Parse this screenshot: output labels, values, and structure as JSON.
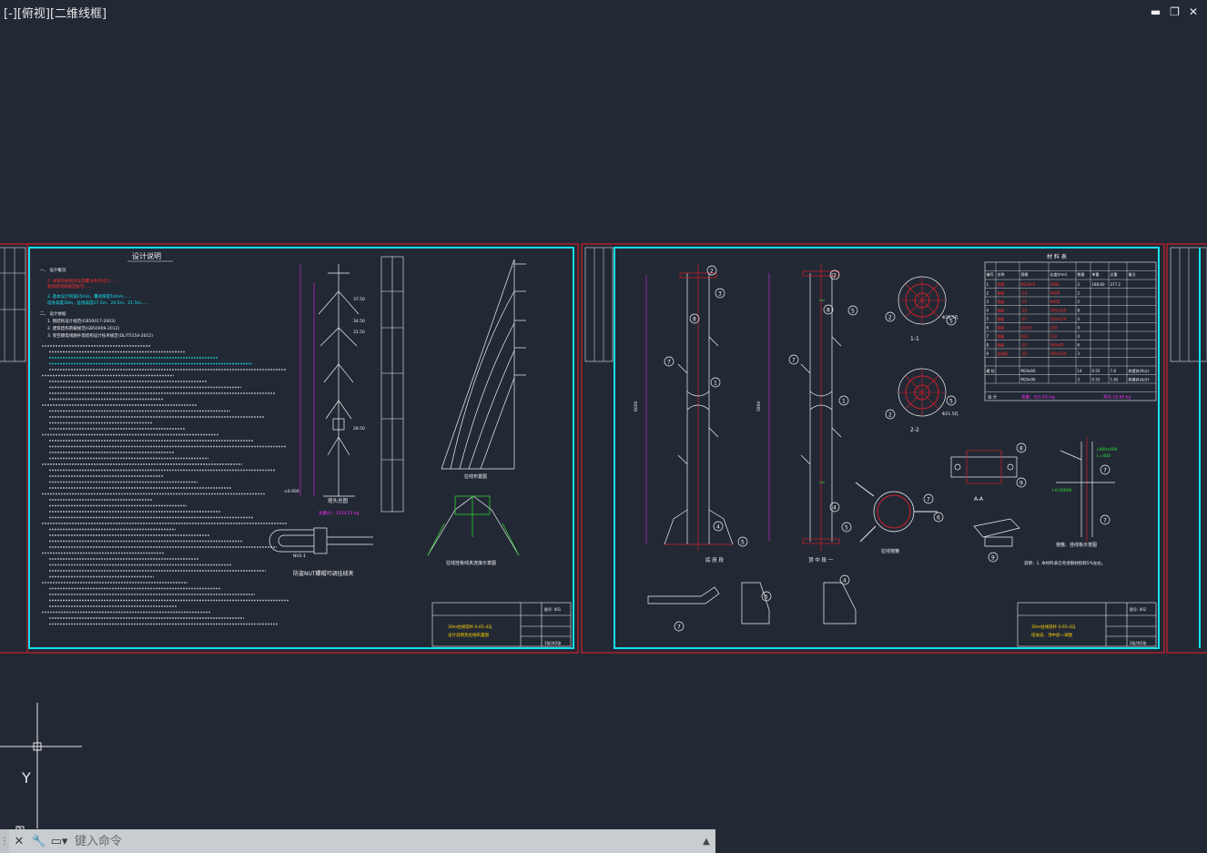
{
  "viewport": {
    "label": "[-][俯视][二维线框]"
  },
  "window_controls": {
    "minimize": "▬",
    "restore": "❐",
    "close": "✕"
  },
  "sheet1": {
    "title": "设计说明",
    "notes_red": [
      "1. 本铁塔按照风压及覆冰条件设计……",
      "   铁塔接地按规范执行……"
    ],
    "notes_cyan": [
      "2. 基本设计风速25m/s，覆冰厚度10mm……",
      "   塔身高度30m，挂线高度27.5m、24.5m、21.5m……"
    ],
    "ref_items": [
      "1. 钢结构设计规范(GB50017-2003)",
      "2. 建筑结构荷载规范(GB50009-2012)",
      "3. 架空输电线路杆塔结构设计技术规定(DL/T5154-2012)"
    ],
    "tower_caption": "塔头总图",
    "tower_weight": "总重(t)：1534.23 kg",
    "nut_caption": "防盗NUT螺帽可调挂线夹",
    "nu_label": "NU1-1",
    "diagram_caption": "拉线布置图",
    "detail_caption": "拉线挂板线夹连接示意图",
    "elevations": [
      "37.50",
      "34.50",
      "31.50",
      "28.50",
      "25.50",
      "±0.000"
    ],
    "title_block": {
      "project": "30m拉线塔杆-0.65-42J",
      "sub": "设计说明及拉线布置图",
      "drawing_no": "图号- 001",
      "scale": "比例",
      "sheet": "1张/共2张"
    }
  },
  "sheet2": {
    "table_title": "材 料 表",
    "table_headers": [
      "编号",
      "名称",
      "规格",
      "长度(mm)",
      "数量",
      "单重",
      "总重",
      "备注"
    ],
    "table_rows": [
      [
        "1",
        "钢管",
        "Φ219x6",
        "5984",
        "2",
        "188.60",
        "377.2",
        ""
      ],
      [
        "2",
        "钢板",
        "-14",
        "Φ500",
        "2",
        "",
        "",
        ""
      ],
      [
        "3",
        "钢板",
        "-16",
        "Φ400",
        "2",
        "",
        "",
        ""
      ],
      [
        "4",
        "钢板",
        "-10",
        "300x250",
        "8",
        "",
        "",
        ""
      ],
      [
        "5",
        "钢板",
        "-25",
        "250x150",
        "4",
        "",
        "",
        ""
      ],
      [
        "6",
        "钢板",
        "L63x5",
        "200",
        "4",
        "",
        "",
        ""
      ],
      [
        "7",
        "钢板",
        "Φ22",
        "150",
        "4",
        "",
        "",
        ""
      ],
      [
        "8",
        "钢板",
        "-10",
        "360x60",
        "6",
        "",
        "",
        ""
      ],
      [
        "9",
        "挂线板",
        "-10",
        "260x100",
        "3",
        "",
        "",
        ""
      ]
    ],
    "bolt_rows": [
      [
        "螺 栓",
        "M20x60",
        "14",
        "0.55",
        "7.8",
        "热镀锌(共计)"
      ],
      [
        "",
        "M20x90",
        "3",
        "0.55",
        "1.65",
        "热镀锌(共计)"
      ]
    ],
    "total_label": "合 计",
    "total_value": "总重：5(5.43) kg",
    "total_value2": "共计 10.65 kg",
    "section1": "1-1",
    "section2": "2-2",
    "section_aa": "A-A",
    "caption_base": "底 座 段",
    "caption_top": "顶 中 段 一",
    "caption_clamp": "拉线抱箍",
    "caption_hang": "抱箍、挂线板示意图",
    "note": "说明：1. 本材料表已考虑钢材损耗5%左右。",
    "heights": [
      "6000",
      "5890"
    ],
    "labels_circle": [
      "1",
      "2",
      "3",
      "4",
      "5",
      "6",
      "7",
      "8",
      "9"
    ],
    "dims": [
      "Φ21.5孔",
      "Φ21.5孔",
      "L450",
      "150",
      "200",
      "60",
      "L400x400",
      "L=400",
      "+0.00600",
      "8000"
    ],
    "title_block": {
      "project": "30m拉线塔杆-0.65-42J",
      "sub": "塔身段、顶中段一详图",
      "drawing_no": "图号- 002",
      "scale": "比例",
      "sheet": "2张/共2张"
    }
  },
  "ucs": {
    "y_label": "Y"
  },
  "command_line": {
    "placeholder": "键入命令",
    "customize_icon": "wrench-icon",
    "close_icon": "close-icon",
    "history_icon": "chevron-up-icon"
  },
  "colors": {
    "background": "#222935",
    "frame_red": "#d01f2a",
    "frame_cyan": "#16e0f0",
    "text_white": "#f2f2f2",
    "text_red": "#ff2b2b",
    "accent_green": "#2ee62e",
    "accent_magenta": "#ff2bff"
  }
}
